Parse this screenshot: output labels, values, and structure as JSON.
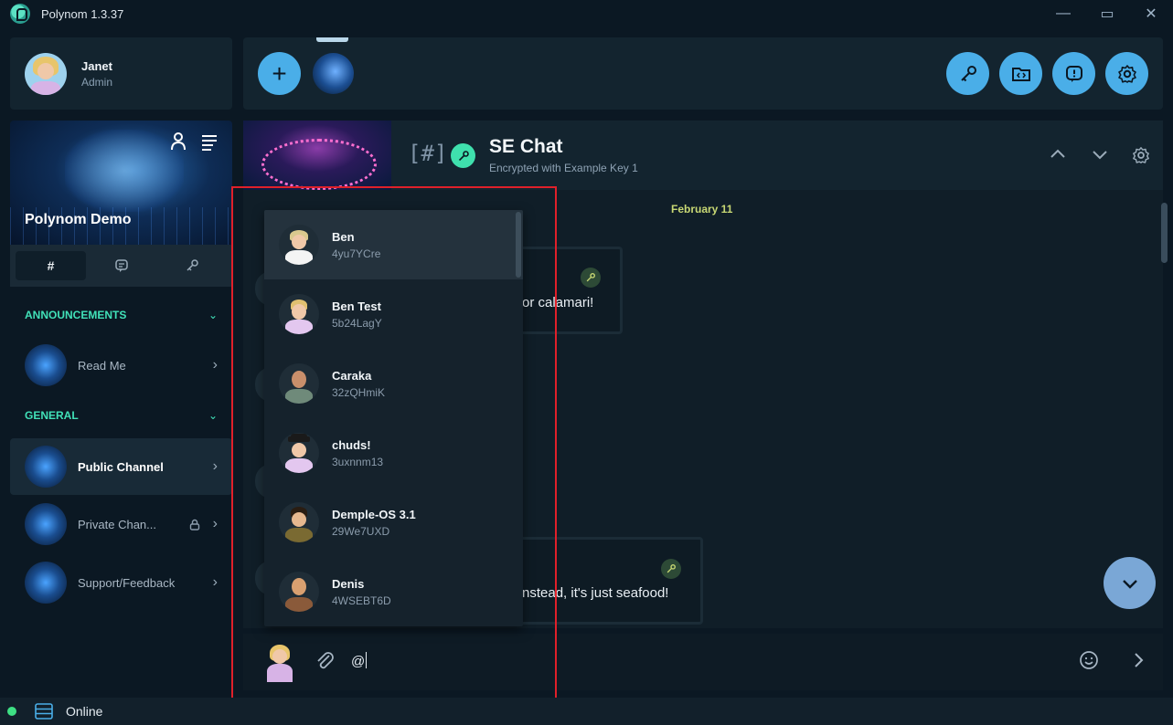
{
  "app": {
    "title": "Polynom 1.3.37"
  },
  "window_controls": {
    "minimize": "—",
    "maximize": "▭",
    "close": "✕"
  },
  "user": {
    "name": "Janet",
    "role": "Admin"
  },
  "server": {
    "name": "Polynom Demo"
  },
  "tabs": [
    {
      "label": "#",
      "icon": "hash-icon"
    },
    {
      "label": "",
      "icon": "chat-bubble-icon"
    },
    {
      "label": "",
      "icon": "key-icon"
    }
  ],
  "sections": [
    {
      "label": "ANNOUNCEMENTS"
    },
    {
      "label": "GENERAL"
    }
  ],
  "channels": [
    {
      "label": "Read Me",
      "locked": false,
      "active": false
    },
    {
      "label": "Public Channel",
      "locked": false,
      "active": true
    },
    {
      "label": "Private Chan...",
      "locked": true,
      "active": false
    },
    {
      "label": "Support/Feedback",
      "locked": false,
      "active": false
    }
  ],
  "topbar": {
    "add_label": "+",
    "actions": [
      {
        "icon": "key-icon"
      },
      {
        "icon": "folder-code-icon"
      },
      {
        "icon": "info-icon"
      },
      {
        "icon": "settings-icon"
      }
    ]
  },
  "channel_header": {
    "hash": "[#]",
    "title": "SE Chat",
    "subtitle": "Encrypted with Example Key 1"
  },
  "chat": {
    "date": "February 11",
    "messages": [
      {
        "partial_text": "or calamari!"
      },
      {
        "partial_text": "nstead, it's just seafood!"
      }
    ]
  },
  "mention_suggestions": [
    {
      "name": "Ben",
      "code": "4yu7YCre",
      "highlighted": true
    },
    {
      "name": "Ben Test",
      "code": "5b24LagY",
      "highlighted": false
    },
    {
      "name": "Caraka",
      "code": "32zQHmiK",
      "highlighted": false
    },
    {
      "name": "chuds!",
      "code": "3uxnnm13",
      "highlighted": false
    },
    {
      "name": "Demple-OS 3.1",
      "code": "29We7UXD",
      "highlighted": false
    },
    {
      "name": "Denis",
      "code": "4WSEBT6D",
      "highlighted": false
    }
  ],
  "composer": {
    "value": "@"
  },
  "status": {
    "text": "Online"
  },
  "colors": {
    "accent": "#4aaee8",
    "section": "#41e1b8",
    "date": "#c8d874",
    "online": "#3ee084",
    "highlight_frame": "#e0202a"
  }
}
